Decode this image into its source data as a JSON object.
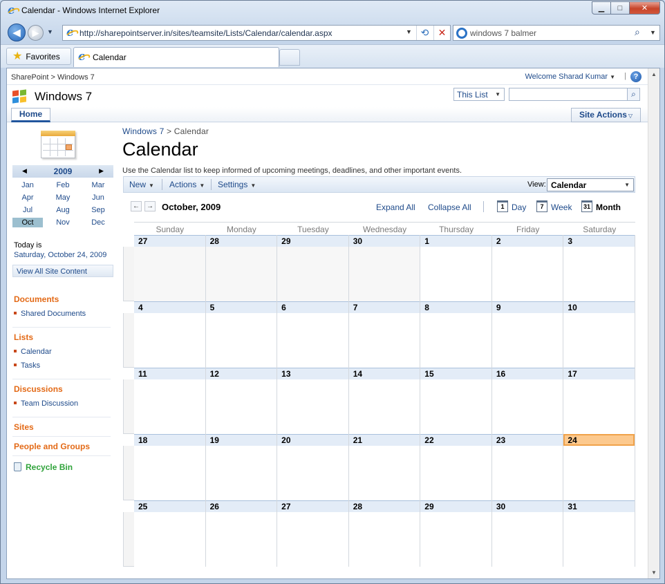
{
  "window": {
    "title": "Calendar - Windows Internet Explorer",
    "controls": {
      "minimize": "▁",
      "maximize": "□",
      "close": "✕"
    }
  },
  "browser": {
    "back": "◀",
    "forward": "▶",
    "address": "http://sharepointserver.in/sites/teamsite/Lists/Calendar/calendar.aspx",
    "search_value": "windows 7 balmer",
    "favorites_label": "Favorites",
    "tab_label": "Calendar",
    "icons": [
      "ie-page-icon",
      "refresh-icon",
      "stop-icon",
      "bing-icon",
      "search-icon",
      "star-icon"
    ]
  },
  "sharepoint": {
    "global_breadcrumb": "SharePoint > Windows 7",
    "welcome": "Welcome Sharad Kumar",
    "help": "?",
    "site_title": "Windows 7",
    "search_scope": "This List",
    "search_placeholder": "",
    "nav_home": "Home",
    "site_actions": "Site Actions"
  },
  "leftnav": {
    "date_picker": {
      "year": "2009",
      "months": [
        "Jan",
        "Feb",
        "Mar",
        "Apr",
        "May",
        "Jun",
        "Jul",
        "Aug",
        "Sep",
        "Oct",
        "Nov",
        "Dec"
      ],
      "selected_month": "Oct"
    },
    "today_label": "Today is",
    "today_date": "Saturday, October 24, 2009",
    "view_all": "View All Site Content",
    "documents": {
      "heading": "Documents",
      "items": [
        "Shared Documents"
      ]
    },
    "lists": {
      "heading": "Lists",
      "items": [
        "Calendar",
        "Tasks"
      ]
    },
    "discussions": {
      "heading": "Discussions",
      "items": [
        "Team Discussion"
      ]
    },
    "sites": "Sites",
    "people": "People and Groups",
    "recycle": "Recycle Bin"
  },
  "main": {
    "breadcrumb_site": "Windows 7",
    "breadcrumb_sep": " > ",
    "breadcrumb_page": "Calendar",
    "title": "Calendar",
    "description": "Use the Calendar list to keep informed of upcoming meetings, deadlines, and other important events.",
    "toolbar": {
      "new": "New",
      "actions": "Actions",
      "settings": "Settings",
      "view_label": "View:",
      "view_value": "Calendar"
    },
    "calendar": {
      "month_label": "October, 2009",
      "expand_all": "Expand All",
      "collapse_all": "Collapse All",
      "day": "Day",
      "day_icon_num": "1",
      "week": "Week",
      "week_icon_num": "7",
      "month": "Month",
      "month_icon_num": "31",
      "weekdays": [
        "Sunday",
        "Monday",
        "Tuesday",
        "Wednesday",
        "Thursday",
        "Friday",
        "Saturday"
      ],
      "weeks": [
        [
          "27",
          "28",
          "29",
          "30",
          "1",
          "2",
          "3"
        ],
        [
          "4",
          "5",
          "6",
          "7",
          "8",
          "9",
          "10"
        ],
        [
          "11",
          "12",
          "13",
          "14",
          "15",
          "16",
          "17"
        ],
        [
          "18",
          "19",
          "20",
          "21",
          "22",
          "23",
          "24"
        ],
        [
          "25",
          "26",
          "27",
          "28",
          "29",
          "30",
          "31"
        ]
      ],
      "today": "24"
    }
  }
}
